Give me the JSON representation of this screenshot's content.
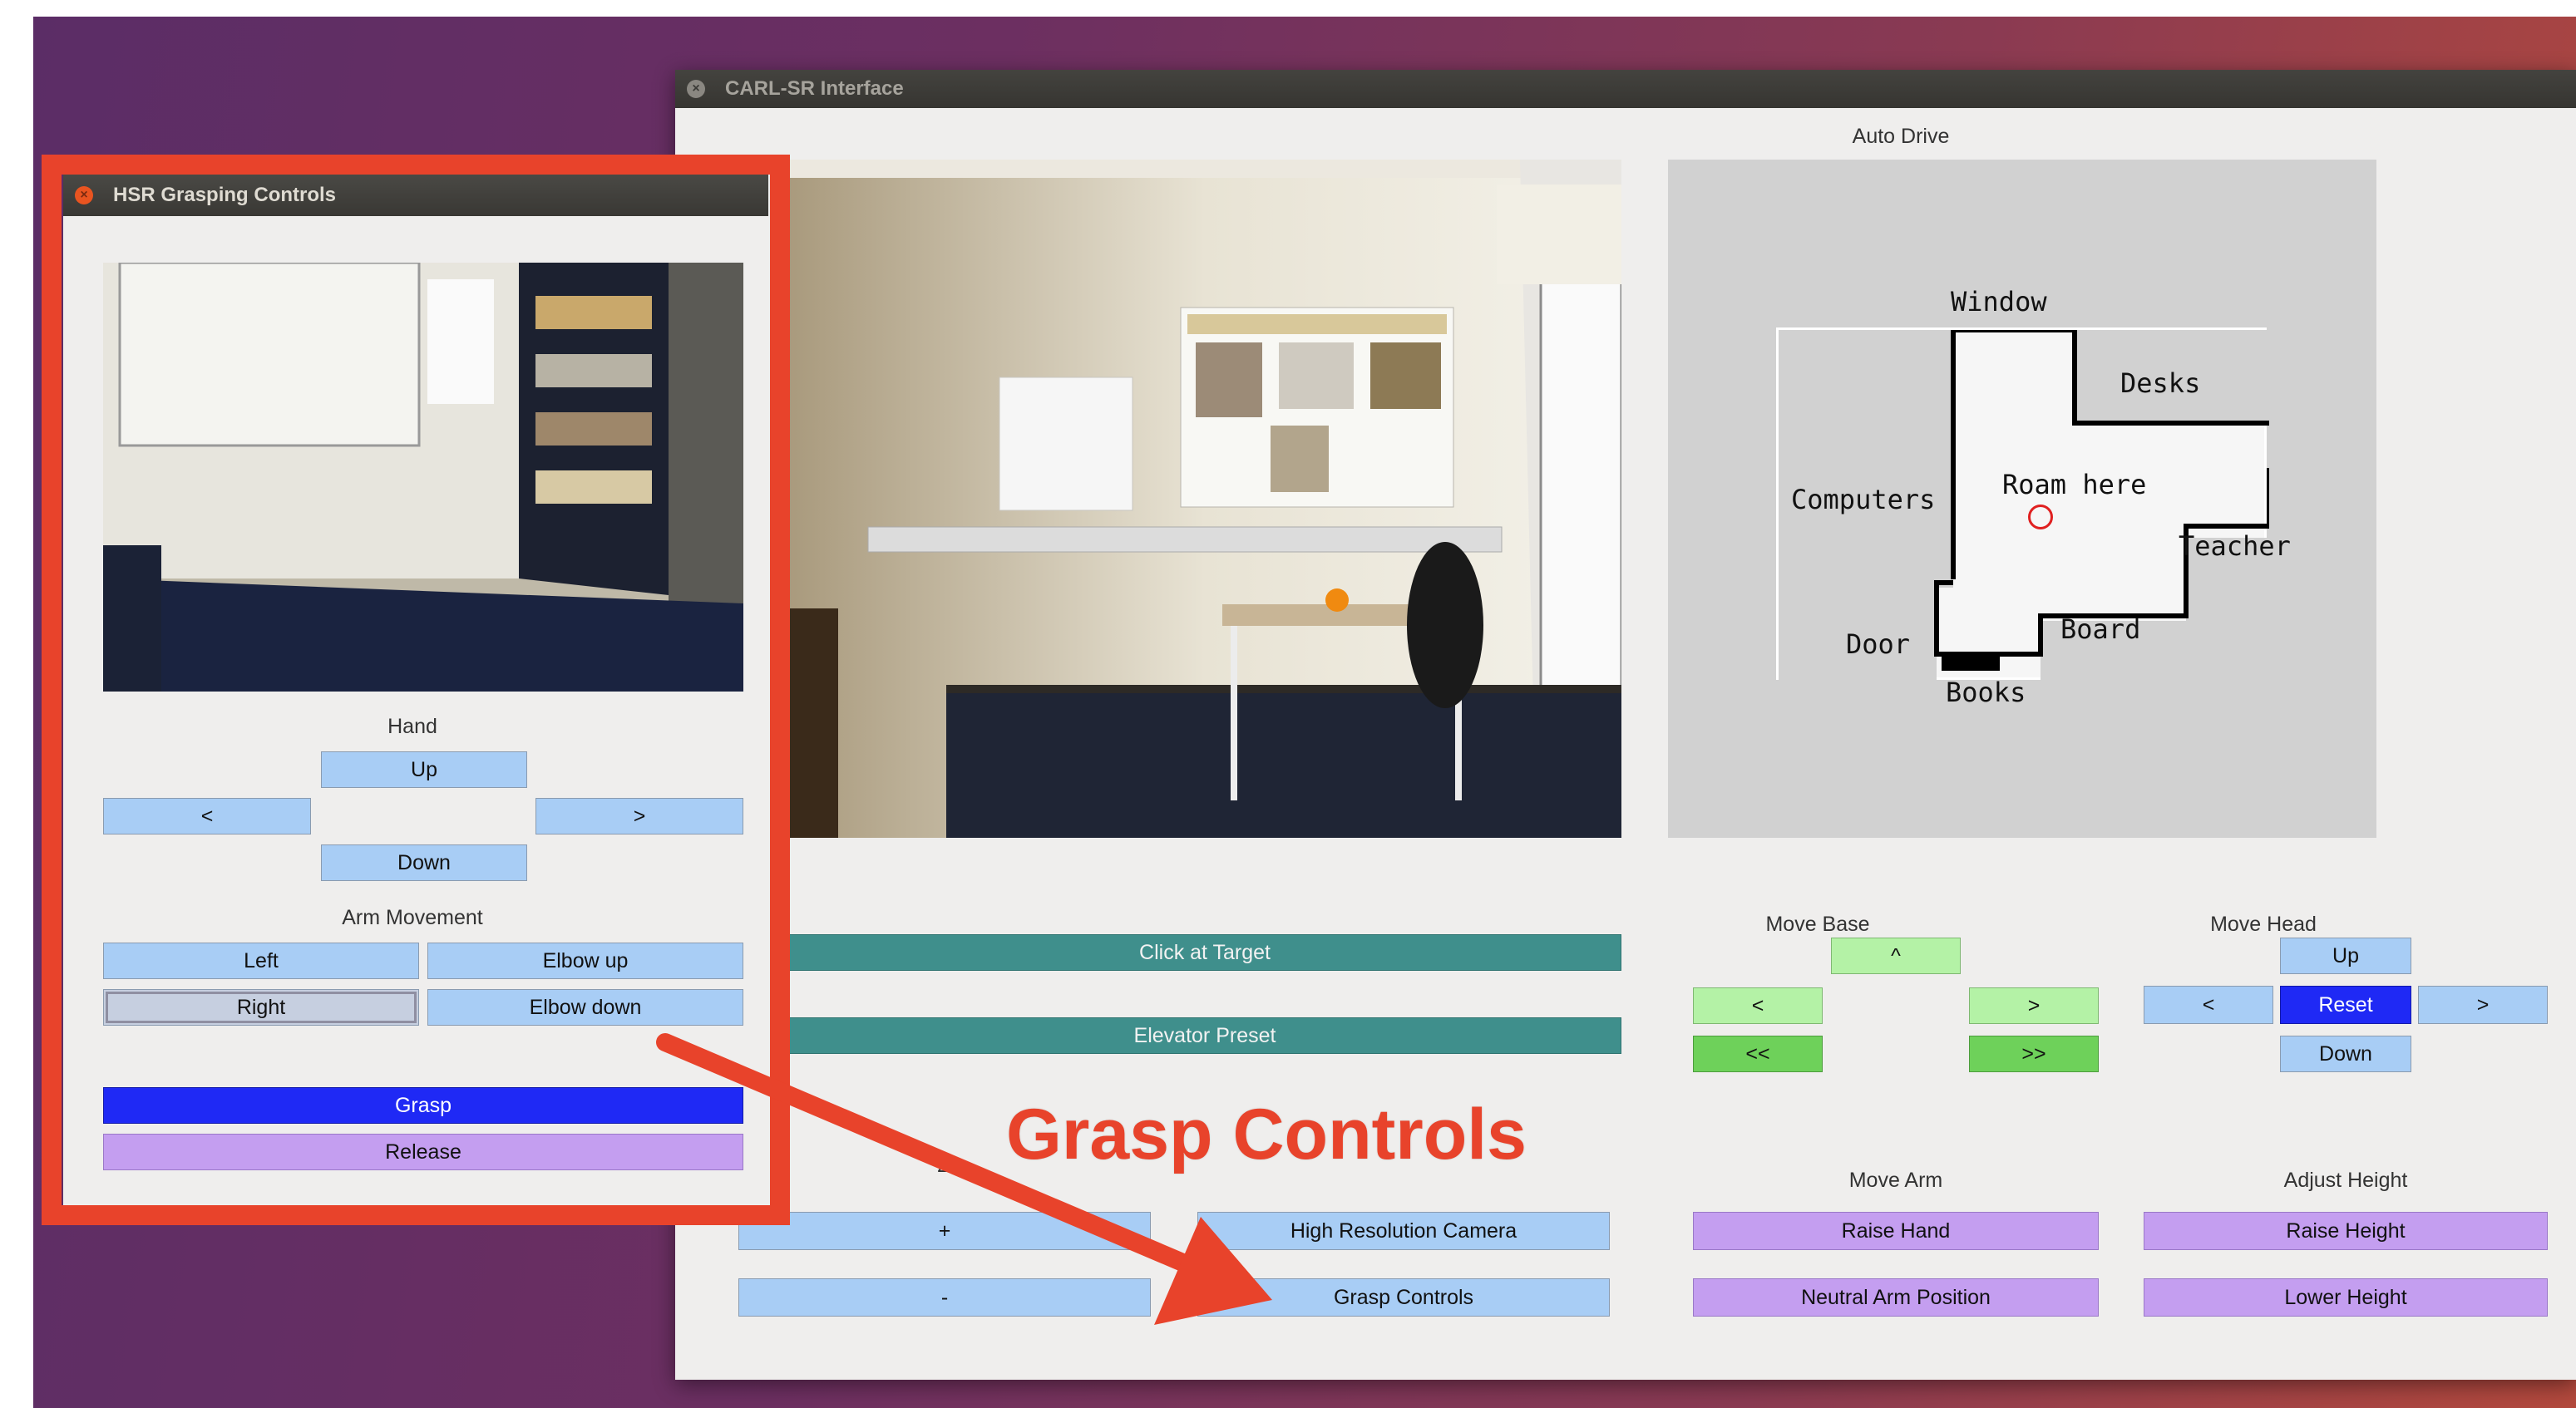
{
  "main_window": {
    "title": "CARL-SR Interface",
    "auto_drive_label": "Auto Drive",
    "map": {
      "window": "Window",
      "desks": "Desks",
      "computers": "Computers",
      "roam": "Roam here",
      "teacher": "Teacher",
      "door": "Door",
      "board": "Board",
      "books": "Books"
    },
    "click_target": "Click at Target",
    "elevator": "Elevator Preset",
    "zoom_label": "Zo",
    "zoom_plus": "+",
    "zoom_minus": "-",
    "high_res": "High Resolution Camera",
    "grasp_controls": "Grasp Controls",
    "move_base": {
      "label": "Move Base",
      "up": "^",
      "left": "<",
      "right": ">",
      "fast_left": "<<",
      "fast_right": ">>"
    },
    "move_head": {
      "label": "Move Head",
      "up": "Up",
      "left": "<",
      "reset": "Reset",
      "right": ">",
      "down": "Down"
    },
    "move_arm": {
      "label": "Move Arm",
      "raise_hand": "Raise Hand",
      "neutral": "Neutral Arm Position"
    },
    "adjust_height": {
      "label": "Adjust Height",
      "raise": "Raise Height",
      "lower": "Lower Height"
    }
  },
  "grasp_window": {
    "title": "HSR Grasping Controls",
    "hand_label": "Hand",
    "hand_up": "Up",
    "hand_left": "<",
    "hand_right": ">",
    "hand_down": "Down",
    "arm_label": "Arm Movement",
    "arm_left": "Left",
    "elbow_up": "Elbow up",
    "arm_right": "Right",
    "elbow_down": "Elbow down",
    "grasp": "Grasp",
    "release": "Release"
  },
  "annotation": {
    "text": "Grasp Controls",
    "color": "#e8432b"
  },
  "icons": {
    "close": "close-icon"
  }
}
